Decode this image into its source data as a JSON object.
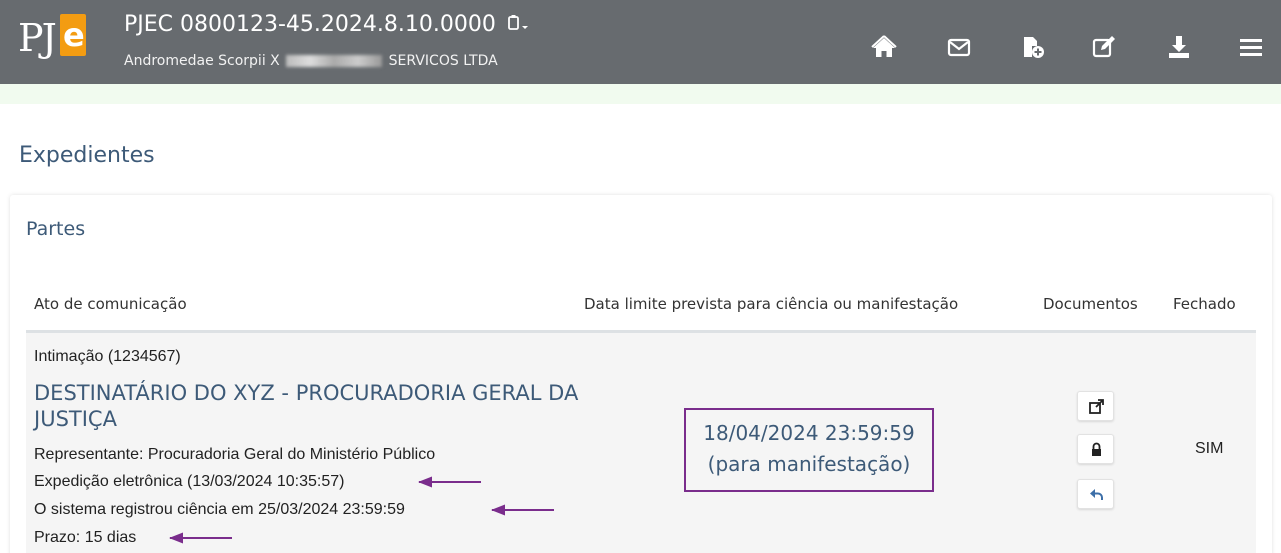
{
  "header": {
    "logo_text": "PJe",
    "process_number": "PJEC 0800123-45.2024.8.10.0000",
    "parties_prefix": "Andromedae Scorpii X",
    "parties_suffix": "SERVICOS LTDA",
    "icons": [
      "home-icon",
      "envelope-icon",
      "new-document-icon",
      "edit-icon",
      "download-icon",
      "menu-icon"
    ],
    "background_color": "#676b6f"
  },
  "page": {
    "title": "Expedientes"
  },
  "section": {
    "title": "Partes",
    "columns": [
      "Ato de comunicação",
      "Data limite prevista para ciência ou manifestação",
      "Documentos",
      "Fechado"
    ],
    "rows": [
      {
        "ato": "Intimação (1234567)",
        "destinatario": "DESTINATÁRIO DO XYZ - PROCURADORIA GERAL DA JUSTIÇA",
        "representante": "Representante: Procuradoria Geral do Ministério Público",
        "expedicao": "Expedição eletrônica (13/03/2024 10:35:57)",
        "ciencia": "O sistema registrou ciência em 25/03/2024 23:59:59",
        "prazo": "Prazo: 15 dias",
        "data_limite": "18/04/2024 23:59:59",
        "data_limite_tipo": "(para manifestação)",
        "documentos_buttons": [
          "external-link-icon",
          "lock-icon",
          "reply-icon"
        ],
        "fechado": "SIM"
      }
    ]
  },
  "colors": {
    "title": "#3d5a78",
    "annotation": "#7a2d8c"
  }
}
